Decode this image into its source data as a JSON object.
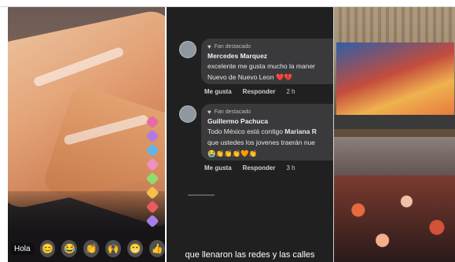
{
  "panels": {
    "left": {
      "reactions": {
        "greeting": "Hola",
        "emojis": [
          "😊",
          "😂",
          "👏",
          "🙌",
          "😁",
          "👍"
        ]
      }
    },
    "middle": {
      "comments": [
        {
          "badge": "Fan destacado",
          "name": "Mercedes Marquez",
          "line1": "excelente me gusta mucho la maner",
          "line2": "Nuevo de Nuevo Leon ❤️💔",
          "like_label": "Me gusta",
          "reply_label": "Responder",
          "time": "2 h"
        },
        {
          "badge": "Fan destacado",
          "name": "Guillermo Pachuca",
          "line1_prefix": "Todo México está contigo ",
          "line1_highlight": "Mariana R",
          "line2": "que ustedes los jovenes traerán nue",
          "line3": "😭👏👏👏🧡👏",
          "like_label": "Me gusta",
          "reply_label": "Responder",
          "time": "3 h"
        }
      ],
      "caption": "que llenaron las redes y las calles"
    }
  },
  "colors": {
    "comment_bg": "#3a3a3c",
    "panel_dark": "#202021"
  }
}
